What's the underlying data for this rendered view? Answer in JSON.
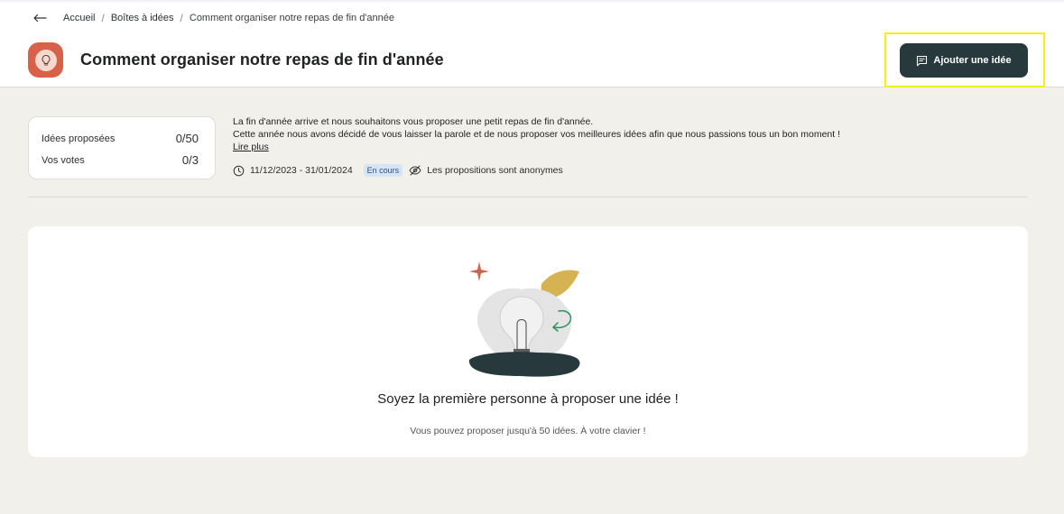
{
  "breadcrumb": {
    "items": [
      "Accueil",
      "Boîtes à idées"
    ],
    "current": "Comment organiser notre repas de fin d'année"
  },
  "header": {
    "title": "Comment organiser notre repas de fin d'année",
    "add_button_label": "Ajouter une idée"
  },
  "stats": {
    "ideas_label": "Idées proposées",
    "ideas_value": "0/50",
    "votes_label": "Vos votes",
    "votes_value": "0/3"
  },
  "description": {
    "line1": "La fin d'année arrive et nous souhaitons vous proposer une petit repas de fin d'année.",
    "line2": "Cette année nous avons décidé de vous laisser la parole et de nous proposer vos meilleures idées afin que nous passions tous un bon moment !",
    "read_more": "Lire plus"
  },
  "meta": {
    "dates": "11/12/2023 - 31/01/2024",
    "status": "En cours",
    "anonymous": "Les propositions sont anonymes"
  },
  "empty_state": {
    "title": "Soyez la première personne à proposer une idée !",
    "subtitle": "Vous pouvez proposer jusqu'à 50 idées. À votre clavier !"
  },
  "colors": {
    "primary_button": "#28393d",
    "app_icon": "#d9614a",
    "background": "#f2f0ea",
    "status_badge": "#d6e4f7",
    "highlight": "#f2ef1a"
  },
  "icons": {
    "back": "arrow-left-icon",
    "app": "lightbulb-icon",
    "add": "comment-icon",
    "clock": "clock-icon",
    "eye": "eye-off-icon"
  }
}
